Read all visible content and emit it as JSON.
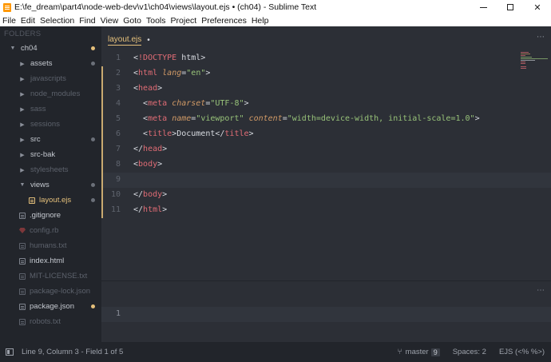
{
  "window": {
    "title": "E:\\fe_dream\\part4\\node-web-dev\\v1\\ch04\\views\\layout.ejs • (ch04) - Sublime Text",
    "controls": {
      "minimize": "minimize",
      "maximize": "maximize",
      "close": "✕"
    }
  },
  "menu": [
    "File",
    "Edit",
    "Selection",
    "Find",
    "View",
    "Goto",
    "Tools",
    "Project",
    "Preferences",
    "Help"
  ],
  "sidebar": {
    "header": "FOLDERS",
    "items": [
      {
        "label": "ch04",
        "kind": "folder-open",
        "indent": 0,
        "style": "normal",
        "dot": "yellow"
      },
      {
        "label": "assets",
        "kind": "folder",
        "indent": 1,
        "style": "normal",
        "dot": "gray"
      },
      {
        "label": "javascripts",
        "kind": "folder",
        "indent": 1,
        "style": "dim",
        "dot": ""
      },
      {
        "label": "node_modules",
        "kind": "folder",
        "indent": 1,
        "style": "dim",
        "dot": ""
      },
      {
        "label": "sass",
        "kind": "folder",
        "indent": 1,
        "style": "dim",
        "dot": ""
      },
      {
        "label": "sessions",
        "kind": "folder",
        "indent": 1,
        "style": "dim",
        "dot": ""
      },
      {
        "label": "src",
        "kind": "folder",
        "indent": 1,
        "style": "normal",
        "dot": "gray"
      },
      {
        "label": "src-bak",
        "kind": "folder",
        "indent": 1,
        "style": "normal",
        "dot": ""
      },
      {
        "label": "stylesheets",
        "kind": "folder",
        "indent": 1,
        "style": "dim",
        "dot": ""
      },
      {
        "label": "views",
        "kind": "folder-open",
        "indent": 1,
        "style": "normal",
        "dot": "gray"
      },
      {
        "label": "layout.ejs",
        "kind": "file",
        "indent": 2,
        "style": "active",
        "dot": "gray"
      },
      {
        "label": ".gitignore",
        "kind": "file",
        "indent": 1,
        "style": "normal",
        "dot": ""
      },
      {
        "label": "config.rb",
        "kind": "ruby",
        "indent": 1,
        "style": "dim",
        "dot": ""
      },
      {
        "label": "humans.txt",
        "kind": "file",
        "indent": 1,
        "style": "dim",
        "dot": ""
      },
      {
        "label": "index.html",
        "kind": "file",
        "indent": 1,
        "style": "normal",
        "dot": ""
      },
      {
        "label": "MIT-LICENSE.txt",
        "kind": "file",
        "indent": 1,
        "style": "dim",
        "dot": ""
      },
      {
        "label": "package-lock.json",
        "kind": "file",
        "indent": 1,
        "style": "dim",
        "dot": ""
      },
      {
        "label": "package.json",
        "kind": "file",
        "indent": 1,
        "style": "normal",
        "dot": "yellow"
      },
      {
        "label": "robots.txt",
        "kind": "file",
        "indent": 1,
        "style": "dim",
        "dot": ""
      }
    ]
  },
  "tab": {
    "label": "layout.ejs",
    "dirty_marker": "•",
    "menu_icon": "⋯"
  },
  "editor": {
    "current_line": 9,
    "modified_lines": [
      2,
      11
    ],
    "lines": [
      [
        [
          "punc",
          "<"
        ],
        [
          "kw",
          "!DOCTYPE"
        ],
        [
          "punc",
          " html>"
        ]
      ],
      [
        [
          "punc",
          "<"
        ],
        [
          "tag",
          "html"
        ],
        [
          "punc",
          " "
        ],
        [
          "attr",
          "lang"
        ],
        [
          "punc",
          "="
        ],
        [
          "str",
          "\"en\""
        ],
        [
          "punc",
          ">"
        ]
      ],
      [
        [
          "punc",
          "<"
        ],
        [
          "tag",
          "head"
        ],
        [
          "punc",
          ">"
        ]
      ],
      [
        [
          "punc",
          "  <"
        ],
        [
          "tag",
          "meta"
        ],
        [
          "punc",
          " "
        ],
        [
          "attr",
          "charset"
        ],
        [
          "punc",
          "="
        ],
        [
          "str",
          "\"UTF-8\""
        ],
        [
          "punc",
          ">"
        ]
      ],
      [
        [
          "punc",
          "  <"
        ],
        [
          "tag",
          "meta"
        ],
        [
          "punc",
          " "
        ],
        [
          "attr",
          "name"
        ],
        [
          "punc",
          "="
        ],
        [
          "str",
          "\"viewport\""
        ],
        [
          "punc",
          " "
        ],
        [
          "attr",
          "content"
        ],
        [
          "punc",
          "="
        ],
        [
          "str",
          "\"width=device-width, initial-scale=1.0\""
        ],
        [
          "punc",
          ">"
        ]
      ],
      [
        [
          "punc",
          "  <"
        ],
        [
          "tag",
          "title"
        ],
        [
          "punc",
          ">Document</"
        ],
        [
          "tag",
          "title"
        ],
        [
          "punc",
          ">"
        ]
      ],
      [
        [
          "punc",
          "</"
        ],
        [
          "tag",
          "head"
        ],
        [
          "punc",
          ">"
        ]
      ],
      [
        [
          "punc",
          "<"
        ],
        [
          "tag",
          "body"
        ],
        [
          "punc",
          ">"
        ]
      ],
      [],
      [
        [
          "punc",
          "</"
        ],
        [
          "tag",
          "body"
        ],
        [
          "punc",
          ">"
        ]
      ],
      [
        [
          "punc",
          "</"
        ],
        [
          "tag",
          "html"
        ],
        [
          "punc",
          ">"
        ]
      ]
    ],
    "colors": {
      "tag": "#e06c75",
      "attr": "#d19a66",
      "string": "#98c379",
      "text": "#d7dae0",
      "background": "#2c2f36"
    }
  },
  "panel": {
    "line_number": "1",
    "menu_icon": "⋯"
  },
  "status": {
    "position": "Line 9, Column 3 - Field 1 of 5",
    "branch": "master",
    "branch_count": "9",
    "indent": "Spaces: 2",
    "syntax": "EJS (<% %>)"
  }
}
